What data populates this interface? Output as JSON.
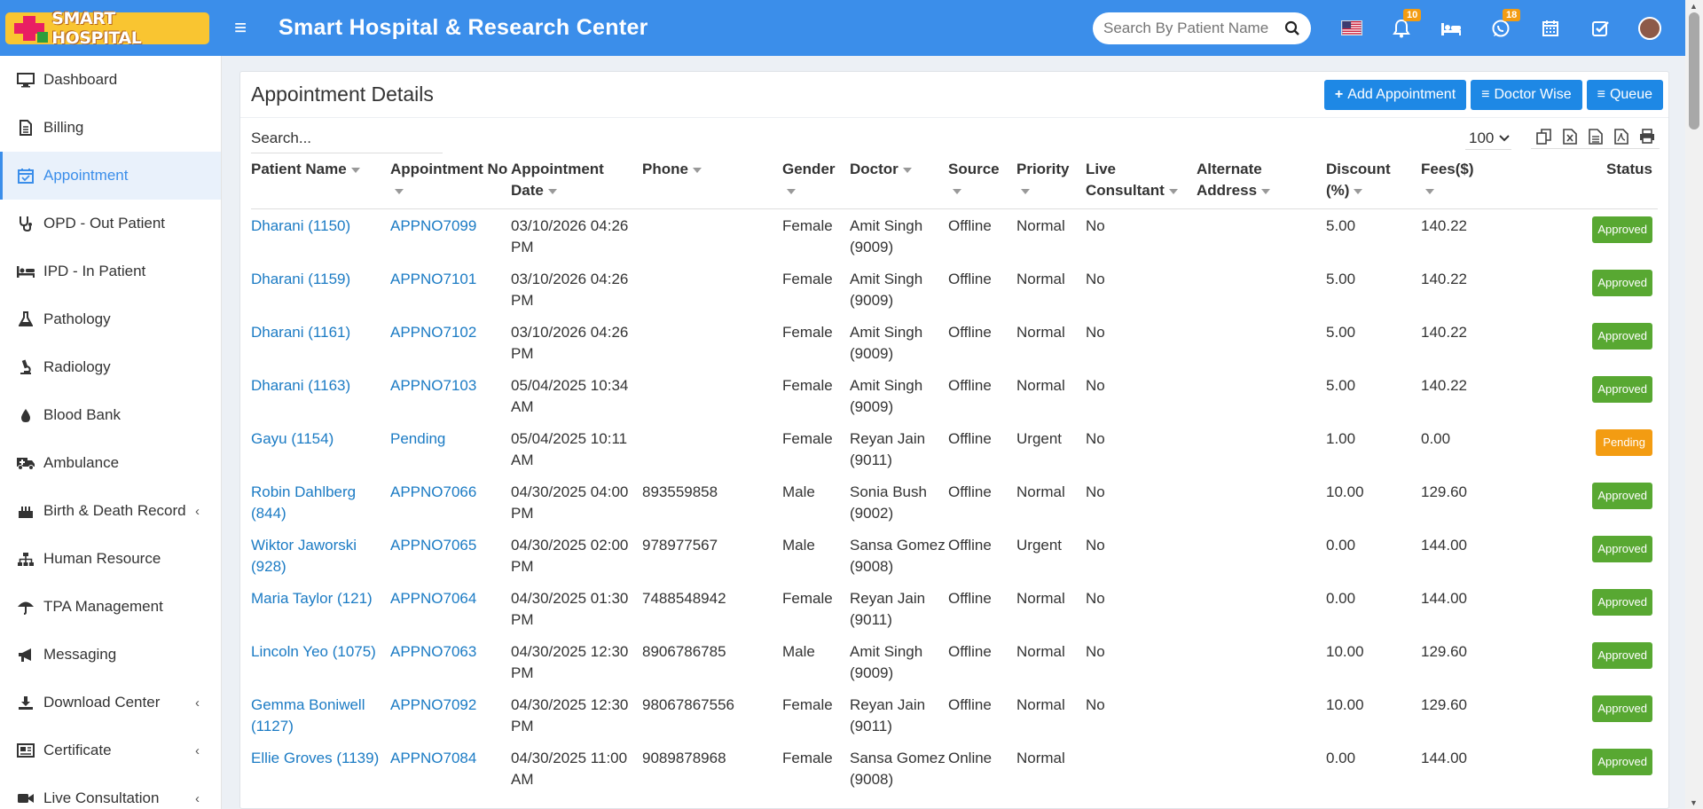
{
  "header": {
    "logo_text": "SMART HOSPITAL",
    "title": "Smart Hospital & Research Center",
    "search_placeholder": "Search By Patient Name",
    "notifications_count": "10",
    "whatsapp_count": "18"
  },
  "sidebar": {
    "items": [
      {
        "label": "Dashboard",
        "icon": "monitor-icon"
      },
      {
        "label": "Billing",
        "icon": "document-icon"
      },
      {
        "label": "Appointment",
        "icon": "calendar-check-icon"
      },
      {
        "label": "OPD - Out Patient",
        "icon": "stethoscope-icon"
      },
      {
        "label": "IPD - In Patient",
        "icon": "bed-icon"
      },
      {
        "label": "Pathology",
        "icon": "flask-icon"
      },
      {
        "label": "Radiology",
        "icon": "microscope-icon"
      },
      {
        "label": "Blood Bank",
        "icon": "droplet-icon"
      },
      {
        "label": "Ambulance",
        "icon": "ambulance-icon"
      },
      {
        "label": "Birth & Death Record",
        "icon": "birthday-cake-icon"
      },
      {
        "label": "Human Resource",
        "icon": "sitemap-icon"
      },
      {
        "label": "TPA Management",
        "icon": "umbrella-icon"
      },
      {
        "label": "Messaging",
        "icon": "bullhorn-icon"
      },
      {
        "label": "Download Center",
        "icon": "download-icon"
      },
      {
        "label": "Certificate",
        "icon": "certificate-icon"
      },
      {
        "label": "Live Consultation",
        "icon": "video-icon"
      }
    ],
    "active": "Appointment"
  },
  "main": {
    "title": "Appointment Details",
    "buttons": {
      "add": "Add Appointment",
      "doctor_wise": "Doctor Wise",
      "queue": "Queue"
    },
    "search_placeholder": "Search...",
    "page_size": "100",
    "columns": {
      "patient_name": "Patient Name",
      "appointment_no": "Appointment No",
      "appointment_date_1": "Appointment",
      "appointment_date_2": "Date",
      "phone": "Phone",
      "gender": "Gender",
      "doctor": "Doctor",
      "source": "Source",
      "priority": "Priority",
      "live_1": "Live",
      "live_2": "Consultant",
      "alt_1": "Alternate",
      "alt_2": "Address",
      "discount_1": "Discount",
      "discount_2": "(%)",
      "fees": "Fees($)",
      "status": "Status"
    },
    "rows": [
      {
        "patient": "Dharani (1150)",
        "appt_no": "APPNO7099",
        "date1": "03/10/2026 04:26",
        "date2": "PM",
        "phone": "",
        "gender": "Female",
        "doctor1": "Amit Singh",
        "doctor2": "(9009)",
        "source": "Offline",
        "priority": "Normal",
        "live": "No",
        "alt": "",
        "discount": "5.00",
        "fees": "140.22",
        "status": "Approved"
      },
      {
        "patient": "Dharani (1159)",
        "appt_no": "APPNO7101",
        "date1": "03/10/2026 04:26",
        "date2": "PM",
        "phone": "",
        "gender": "Female",
        "doctor1": "Amit Singh",
        "doctor2": "(9009)",
        "source": "Offline",
        "priority": "Normal",
        "live": "No",
        "alt": "",
        "discount": "5.00",
        "fees": "140.22",
        "status": "Approved"
      },
      {
        "patient": "Dharani (1161)",
        "appt_no": "APPNO7102",
        "date1": "03/10/2026 04:26",
        "date2": "PM",
        "phone": "",
        "gender": "Female",
        "doctor1": "Amit Singh",
        "doctor2": "(9009)",
        "source": "Offline",
        "priority": "Normal",
        "live": "No",
        "alt": "",
        "discount": "5.00",
        "fees": "140.22",
        "status": "Approved"
      },
      {
        "patient": "Dharani (1163)",
        "appt_no": "APPNO7103",
        "date1": "05/04/2025 10:34",
        "date2": "AM",
        "phone": "",
        "gender": "Female",
        "doctor1": "Amit Singh",
        "doctor2": "(9009)",
        "source": "Offline",
        "priority": "Normal",
        "live": "No",
        "alt": "",
        "discount": "5.00",
        "fees": "140.22",
        "status": "Approved"
      },
      {
        "patient": "Gayu (1154)",
        "appt_no": "Pending",
        "date1": "05/04/2025 10:11",
        "date2": "AM",
        "phone": "",
        "gender": "Female",
        "doctor1": "Reyan Jain",
        "doctor2": "(9011)",
        "source": "Offline",
        "priority": "Urgent",
        "live": "No",
        "alt": "",
        "discount": "1.00",
        "fees": "0.00",
        "status": "Pending"
      },
      {
        "patient": "Robin Dahlberg",
        "patient2": "(844)",
        "appt_no": "APPNO7066",
        "date1": "04/30/2025 04:00",
        "date2": "PM",
        "phone": "893559858",
        "gender": "Male",
        "doctor1": "Sonia Bush",
        "doctor2": "(9002)",
        "source": "Offline",
        "priority": "Normal",
        "live": "No",
        "alt": "",
        "discount": "10.00",
        "fees": "129.60",
        "status": "Approved"
      },
      {
        "patient": "Wiktor Jaworski",
        "patient2": "(928)",
        "appt_no": "APPNO7065",
        "date1": "04/30/2025 02:00",
        "date2": "PM",
        "phone": "978977567",
        "gender": "Male",
        "doctor1": "Sansa Gomez",
        "doctor2": "(9008)",
        "source": "Offline",
        "priority": "Urgent",
        "live": "No",
        "alt": "",
        "discount": "0.00",
        "fees": "144.00",
        "status": "Approved"
      },
      {
        "patient": "Maria Taylor (121)",
        "appt_no": "APPNO7064",
        "date1": "04/30/2025 01:30",
        "date2": "PM",
        "phone": "7488548942",
        "gender": "Female",
        "doctor1": "Reyan Jain",
        "doctor2": "(9011)",
        "source": "Offline",
        "priority": "Normal",
        "live": "No",
        "alt": "",
        "discount": "0.00",
        "fees": "144.00",
        "status": "Approved"
      },
      {
        "patient": "Lincoln Yeo (1075)",
        "appt_no": "APPNO7063",
        "date1": "04/30/2025 12:30",
        "date2": "PM",
        "phone": "8906786785",
        "gender": "Male",
        "doctor1": "Amit Singh",
        "doctor2": "(9009)",
        "source": "Offline",
        "priority": "Normal",
        "live": "No",
        "alt": "",
        "discount": "10.00",
        "fees": "129.60",
        "status": "Approved"
      },
      {
        "patient": "Gemma Boniwell",
        "patient2": "(1127)",
        "appt_no": "APPNO7092",
        "date1": "04/30/2025 12:30",
        "date2": "PM",
        "phone": "98067867556",
        "gender": "Female",
        "doctor1": "Reyan Jain",
        "doctor2": "(9011)",
        "source": "Offline",
        "priority": "Normal",
        "live": "No",
        "alt": "",
        "discount": "10.00",
        "fees": "129.60",
        "status": "Approved"
      },
      {
        "patient": "Ellie Groves (1139)",
        "appt_no": "APPNO7084",
        "date1": "04/30/2025 11:00",
        "date2": "AM",
        "phone": "9089878968",
        "gender": "Female",
        "doctor1": "Sansa Gomez",
        "doctor2": "(9008)",
        "source": "Online",
        "priority": "Normal",
        "live": "",
        "alt": "",
        "discount": "0.00",
        "fees": "144.00",
        "status": "Approved"
      }
    ]
  },
  "colors": {
    "header_bg": "#3b8eea",
    "accent": "#1e88e5",
    "link": "#1b7bc4",
    "approved": "#58a832",
    "pending": "#f39c12"
  }
}
